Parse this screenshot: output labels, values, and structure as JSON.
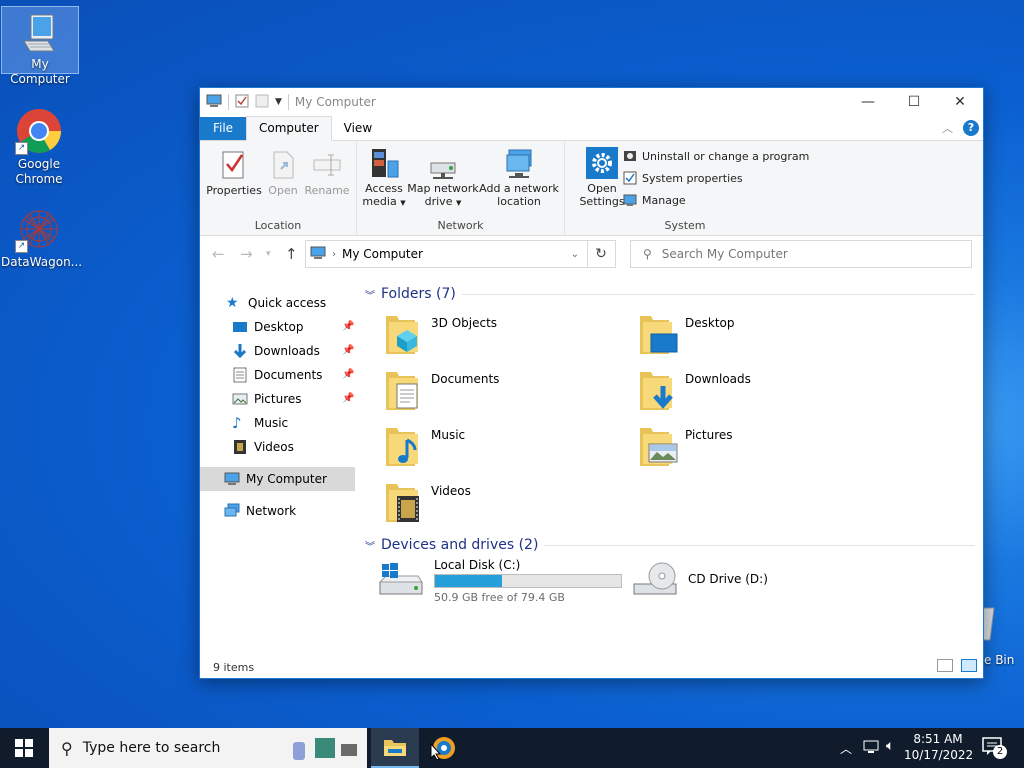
{
  "desktop": {
    "icons": [
      {
        "label": "My Computer"
      },
      {
        "label": "Google Chrome"
      },
      {
        "label": "DataWagon..."
      }
    ],
    "recycle_bin_partial": "e Bin"
  },
  "window": {
    "title": "My Computer",
    "tabs": [
      "File",
      "Computer",
      "View"
    ],
    "ribbon": {
      "location": {
        "label": "Location",
        "buttons": [
          "Properties",
          "Open",
          "Rename"
        ]
      },
      "network": {
        "label": "Network",
        "access_media": [
          "Access",
          "media"
        ],
        "map_drive": [
          "Map network",
          "drive"
        ],
        "add_location": [
          "Add a network",
          "location"
        ]
      },
      "system": {
        "label": "System",
        "open_settings": [
          "Open",
          "Settings"
        ],
        "small": [
          "Uninstall or change a program",
          "System properties",
          "Manage"
        ]
      }
    },
    "address": {
      "path": "My Computer",
      "search_placeholder": "Search My Computer"
    },
    "nav": {
      "quick_access": "Quick access",
      "items": [
        "Desktop",
        "Downloads",
        "Documents",
        "Pictures",
        "Music",
        "Videos"
      ],
      "my_computer": "My Computer",
      "network": "Network"
    },
    "folders_header": "Folders (7)",
    "folders": [
      "3D Objects",
      "Desktop",
      "Documents",
      "Downloads",
      "Music",
      "Pictures",
      "Videos"
    ],
    "devices_header": "Devices and drives (2)",
    "drives": [
      {
        "name": "Local Disk (C:)",
        "free": "50.9 GB free of 79.4 GB",
        "used_fraction": 0.359
      },
      {
        "name": "CD Drive (D:)"
      }
    ],
    "status": "9 items"
  },
  "taskbar": {
    "search_placeholder": "Type here to search",
    "time": "8:51 AM",
    "date": "10/17/2022",
    "notification_count": "2"
  },
  "colors": {
    "accent": "#1979ca",
    "section_header": "#1e3287",
    "progress": "#26a0da"
  }
}
